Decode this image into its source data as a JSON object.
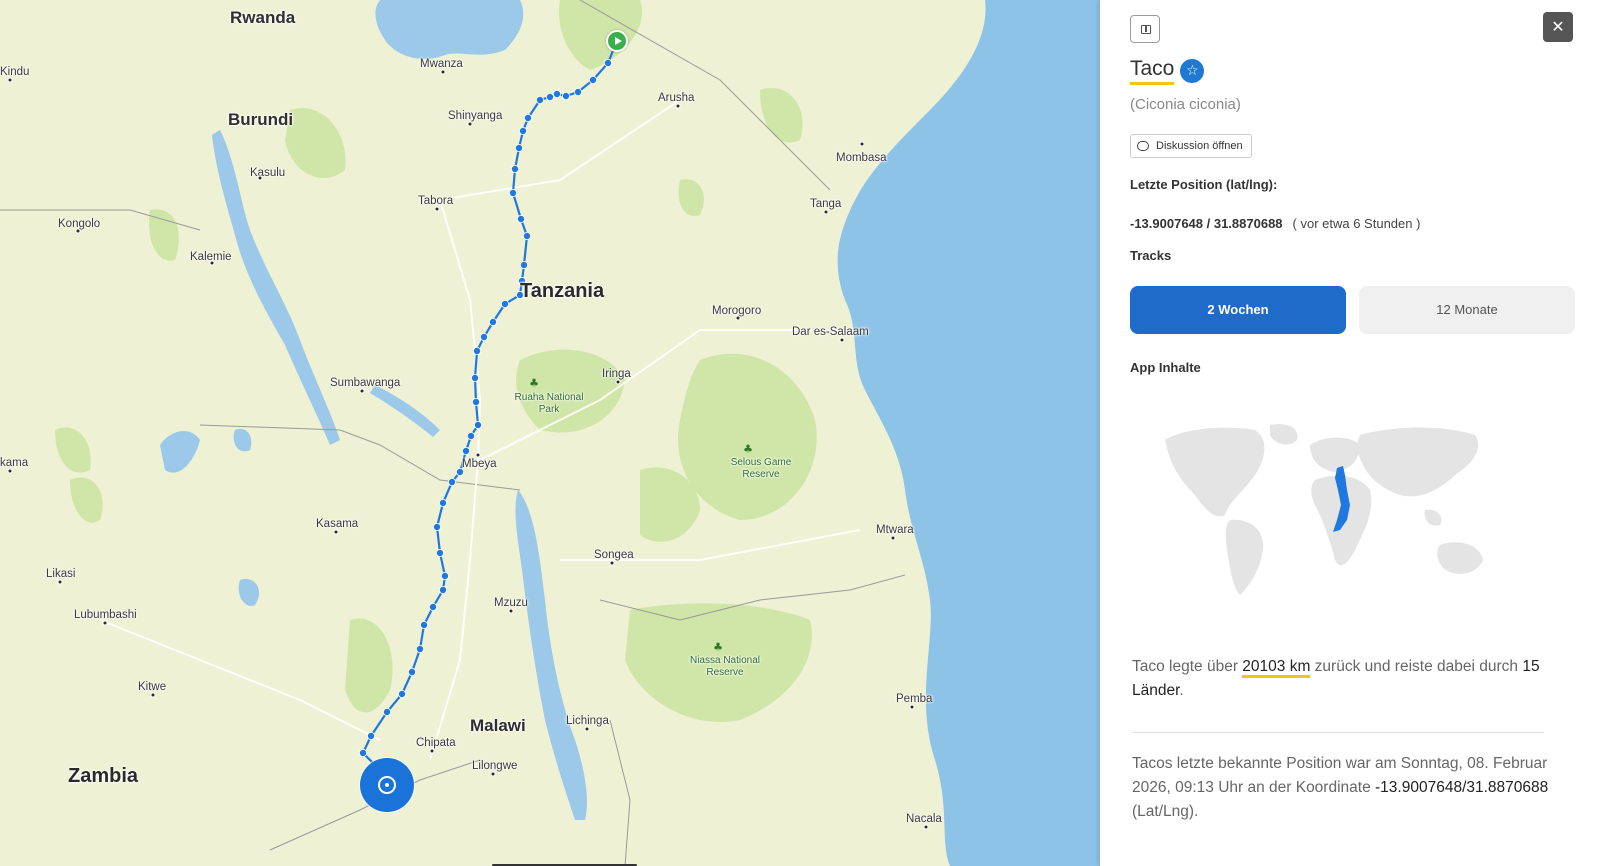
{
  "map": {
    "places": [
      {
        "name": "Rwanda",
        "kind": "country"
      },
      {
        "name": "Burundi",
        "kind": "country"
      },
      {
        "name": "Tanzania",
        "kind": "country-big"
      },
      {
        "name": "Zambia",
        "kind": "country-big"
      },
      {
        "name": "Malawi",
        "kind": "country"
      },
      {
        "name": "Mwanza",
        "kind": "city"
      },
      {
        "name": "Shinyanga",
        "kind": "city"
      },
      {
        "name": "Arusha",
        "kind": "city"
      },
      {
        "name": "Mombasa",
        "kind": "city"
      },
      {
        "name": "Kindu",
        "kind": "city"
      },
      {
        "name": "Kasulu",
        "kind": "city"
      },
      {
        "name": "Tabora",
        "kind": "city"
      },
      {
        "name": "Tanga",
        "kind": "city"
      },
      {
        "name": "Kongolo",
        "kind": "city"
      },
      {
        "name": "Kalemie",
        "kind": "city"
      },
      {
        "name": "Morogoro",
        "kind": "city"
      },
      {
        "name": "Dar es-Salaam",
        "kind": "city"
      },
      {
        "name": "Sumbawanga",
        "kind": "city"
      },
      {
        "name": "Iringa",
        "kind": "city"
      },
      {
        "name": "Mbeya",
        "kind": "city"
      },
      {
        "name": "kama",
        "kind": "city"
      },
      {
        "name": "Kasama",
        "kind": "city"
      },
      {
        "name": "Mtwara",
        "kind": "city"
      },
      {
        "name": "Songea",
        "kind": "city"
      },
      {
        "name": "Likasi",
        "kind": "city"
      },
      {
        "name": "Lubumbashi",
        "kind": "city"
      },
      {
        "name": "Mzuzu",
        "kind": "city"
      },
      {
        "name": "Kitwe",
        "kind": "city"
      },
      {
        "name": "Lichinga",
        "kind": "city"
      },
      {
        "name": "Pemba",
        "kind": "city"
      },
      {
        "name": "Chipata",
        "kind": "city"
      },
      {
        "name": "Lilongwe",
        "kind": "city"
      },
      {
        "name": "Nacala",
        "kind": "city"
      },
      {
        "name": "Ruaha National Park",
        "kind": "park"
      },
      {
        "name": "Selous Game Reserve",
        "kind": "park"
      },
      {
        "name": "Niassa National Reserve",
        "kind": "park"
      }
    ],
    "track_color": "#1f78e0",
    "start_marker": "play-icon",
    "current_marker": "crosshair-icon"
  },
  "panel": {
    "name": "Taco",
    "species": "(Ciconia ciconia)",
    "discussion_label": "Diskussion öffnen",
    "last_position_label": "Letzte Position (lat/lng):",
    "last_position_coords": "-13.9007648 / 31.8870688",
    "last_position_ago": "( vor etwa 6 Stunden )",
    "tracks_label": "Tracks",
    "tracks": [
      {
        "label": "2 Wochen",
        "active": true
      },
      {
        "label": "12 Monate",
        "active": false
      }
    ],
    "app_content_label": "App Inhalte",
    "distance_text_1": "Taco legte über ",
    "distance_value": "20103 km",
    "distance_text_2": " zurück und reiste dabei durch ",
    "countries_value": "15 Länder",
    "distance_text_3": ".",
    "last_known_text": "Tacos letzte bekannte Position war am Sonntag, 08. Februar 2026, 09:13 Uhr an der Koordinate ",
    "last_known_coords": "-13.9007648/31.8870688",
    "last_known_suffix": " (Lat/Lng).",
    "accent_color": "#1f6bc9",
    "highlight_color": "#f0c419"
  }
}
